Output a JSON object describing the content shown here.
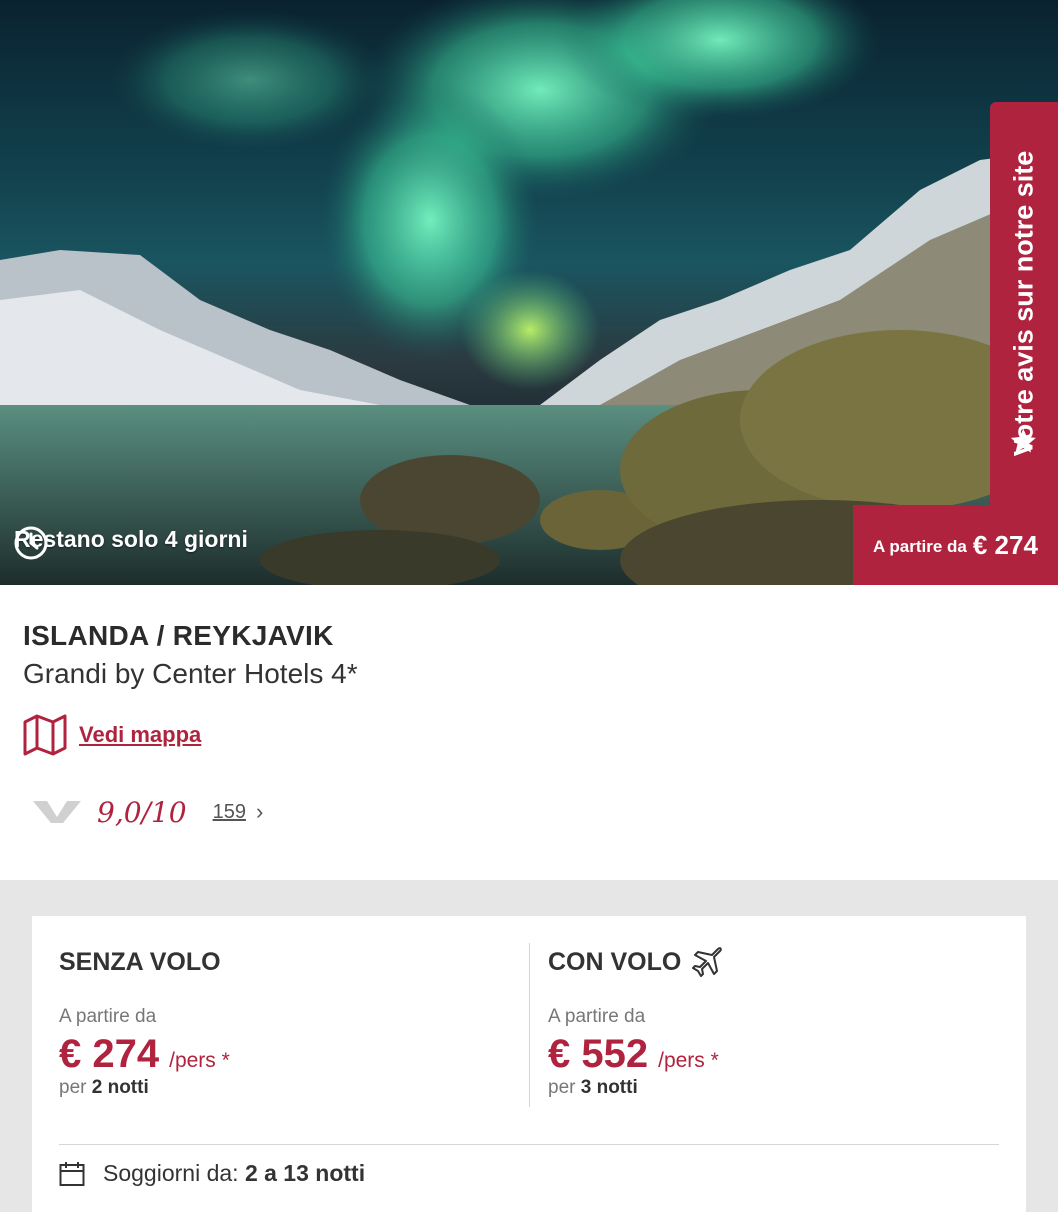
{
  "hero": {
    "countdown_text": "Restano solo 4 giorni",
    "price_badge_label": "A partire da",
    "price_badge_value": "€ 274",
    "review_tab_text": "Votre avis sur notre site"
  },
  "destination": {
    "location": "ISLANDA / REYKJAVIK",
    "hotel_name": "Grandi by Center Hotels 4*",
    "map_link": "Vedi mappa"
  },
  "rating": {
    "score": "9,0/10",
    "review_count": "159"
  },
  "offers": {
    "without_flight": {
      "title": "SENZA VOLO",
      "from_label": "A partire da",
      "price": "€ 274",
      "per": "/pers *",
      "nights_prefix": "per",
      "nights": "2 notti"
    },
    "with_flight": {
      "title": "CON VOLO",
      "from_label": "A partire da",
      "price": "€ 552",
      "per": "/pers *",
      "nights_prefix": "per",
      "nights": "3 notti"
    },
    "stay": {
      "label": "Soggiorni da:",
      "value": "2 a 13 notti"
    }
  },
  "colors": {
    "brand": "#b0233f"
  },
  "icons": [
    "clock-icon",
    "star-icon",
    "map-icon",
    "review-logo-icon",
    "chevron-right-icon",
    "airplane-icon",
    "calendar-icon"
  ]
}
